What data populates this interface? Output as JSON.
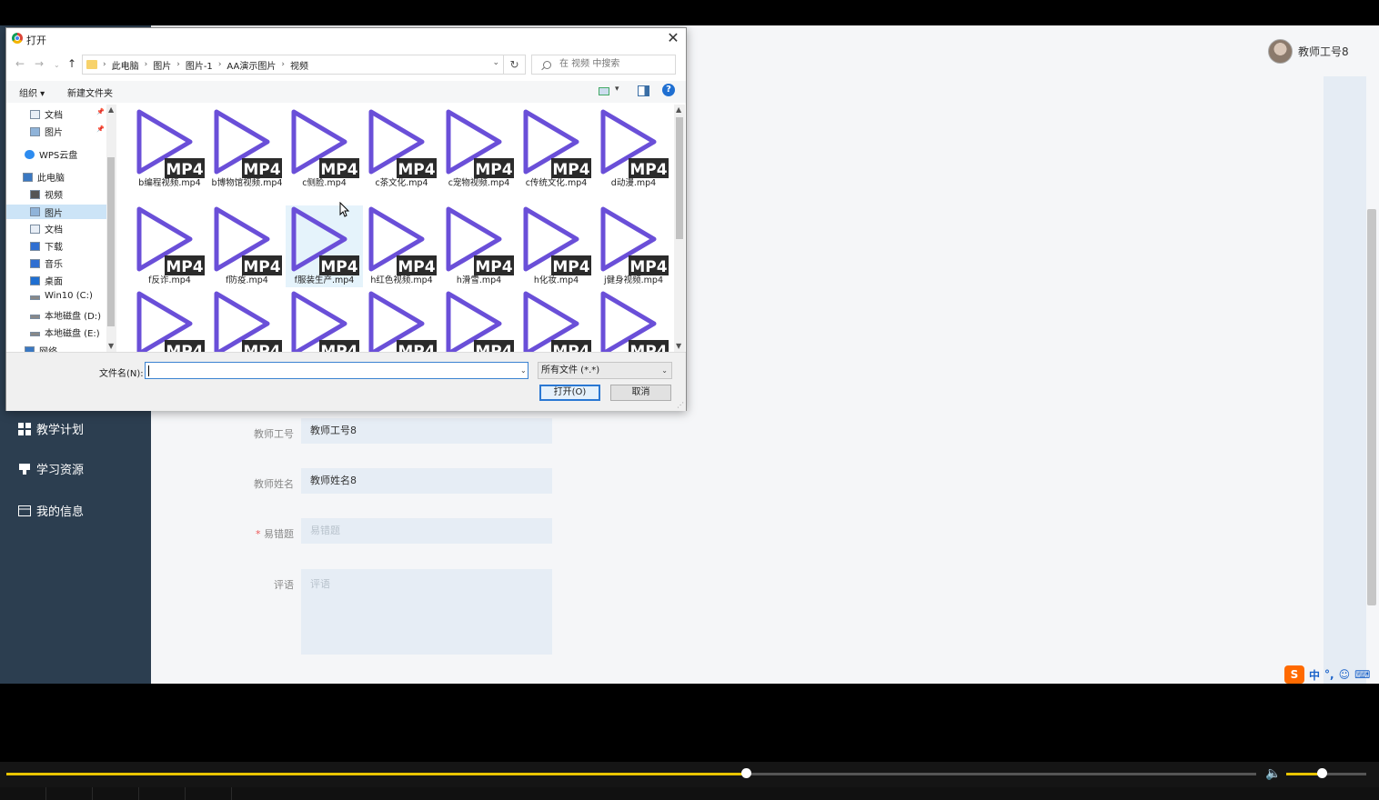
{
  "app": {
    "profile_name": "教师工号8",
    "nav": [
      {
        "label": "教学计划",
        "icon": "grid-icon"
      },
      {
        "label": "学习资源",
        "icon": "podium-icon"
      },
      {
        "label": "我的信息",
        "icon": "card-icon"
      }
    ],
    "form": {
      "teacher_id_label": "教师工号",
      "teacher_id_value": "教师工号8",
      "teacher_name_label": "教师姓名",
      "teacher_name_value": "教师姓名8",
      "required_mark": "*",
      "mistake_label": "易错题",
      "mistake_placeholder": "易错题",
      "comment_label": "评语",
      "comment_placeholder": "评语"
    },
    "ime": {
      "mode": "中",
      "punct": "°,",
      "emoji": "☺",
      "keyboard": "⌨"
    }
  },
  "player": {
    "progress": 0.592,
    "volume": 0.44
  },
  "dialog": {
    "title": "打开",
    "breadcrumb": [
      "此电脑",
      "图片",
      "图片-1",
      "AA演示图片",
      "视频"
    ],
    "search_placeholder": "在 视频 中搜索",
    "toolbar": {
      "organize": "组织 ▾",
      "new_folder": "新建文件夹"
    },
    "tree": [
      {
        "label": "文档",
        "icon": "document-icon",
        "pinned": true
      },
      {
        "label": "图片",
        "icon": "pictures-icon",
        "pinned": true
      },
      {
        "label": "WPS云盘",
        "icon": "cloud-icon"
      },
      {
        "label": "此电脑",
        "icon": "computer-icon"
      },
      {
        "label": "视频",
        "icon": "video-icon"
      },
      {
        "label": "图片",
        "icon": "pictures-icon",
        "selected": true
      },
      {
        "label": "文档",
        "icon": "document-icon"
      },
      {
        "label": "下载",
        "icon": "download-icon"
      },
      {
        "label": "音乐",
        "icon": "music-icon"
      },
      {
        "label": "桌面",
        "icon": "desktop-icon"
      },
      {
        "label": "Win10 (C:)",
        "icon": "drive-icon"
      },
      {
        "label": "本地磁盘 (D:)",
        "icon": "drive-icon"
      },
      {
        "label": "本地磁盘 (E:)",
        "icon": "drive-icon"
      },
      {
        "label": "网络",
        "icon": "network-icon"
      }
    ],
    "file_badge": "MP4",
    "files": [
      "b编程视频.mp4",
      "b博物馆视频.mp4",
      "c侧脸.mp4",
      "c茶文化.mp4",
      "c宠物视频.mp4",
      "c传统文化.mp4",
      "d动漫.mp4",
      "f反诈.mp4",
      "f防疫.mp4",
      "f服装生产.mp4",
      "h红色视频.mp4",
      "h滑雪.mp4",
      "h化妆.mp4",
      "j健身视频.mp4",
      "",
      "",
      "",
      "",
      "",
      "",
      ""
    ],
    "filename_label": "文件名(N):",
    "filename_value": "",
    "filetype": "所有文件 (*.*)",
    "open_label": "打开(O)",
    "cancel_label": "取消"
  }
}
